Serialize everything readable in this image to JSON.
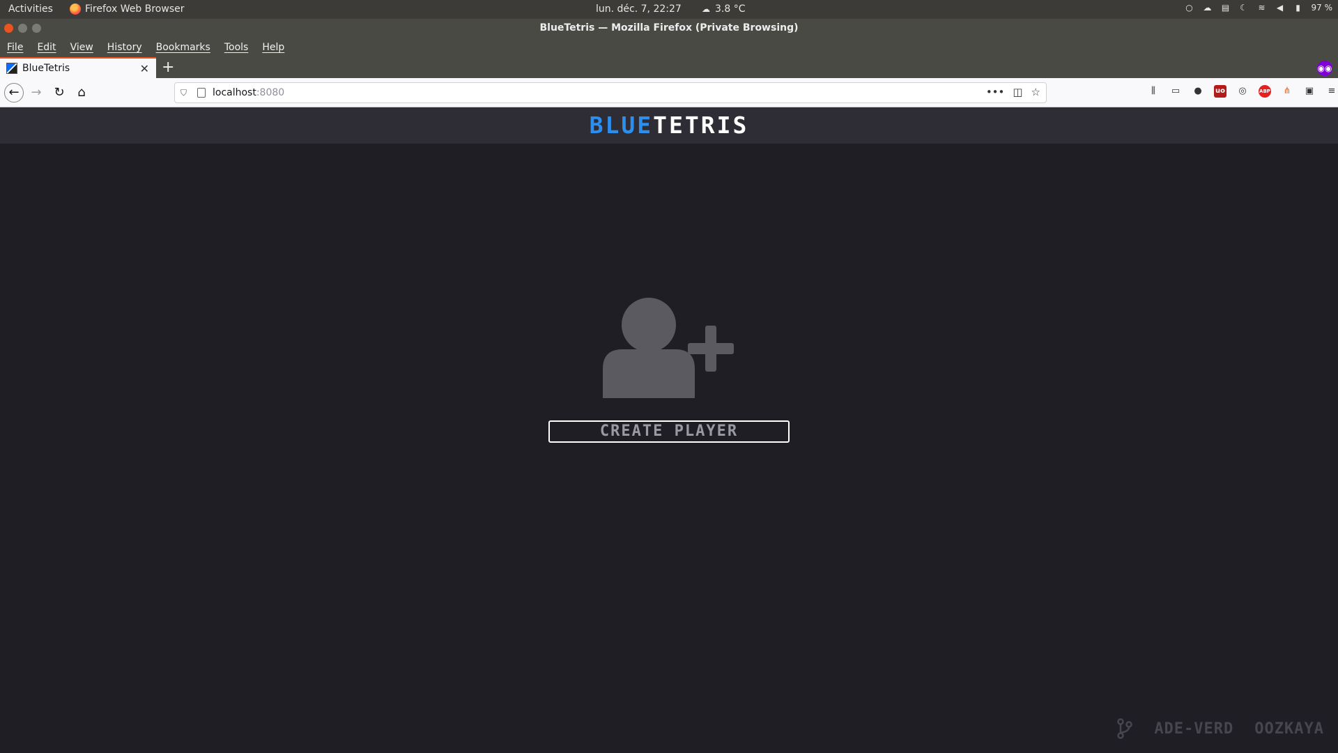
{
  "system": {
    "activities": "Activities",
    "app_name": "Firefox Web Browser",
    "clock": "lun. déc.  7, 22:27",
    "weather": "3.8 °C",
    "battery": "97 %"
  },
  "window": {
    "title": "BlueTetris — Mozilla Firefox (Private Browsing)"
  },
  "menu": [
    {
      "label": "File"
    },
    {
      "label": "Edit"
    },
    {
      "label": "View"
    },
    {
      "label": "History"
    },
    {
      "label": "Bookmarks"
    },
    {
      "label": "Tools"
    },
    {
      "label": "Help"
    }
  ],
  "tab": {
    "title": "BlueTetris"
  },
  "url": {
    "host": "localhost",
    "port": ":8080"
  },
  "app": {
    "brand_blue": "BLUE",
    "brand_white": "TETRIS",
    "create_button": "CREATE PLAYER",
    "footer_names": [
      "ADE-VERD",
      "OOZKAYA"
    ]
  },
  "colors": {
    "accent": "#2b8ff0",
    "background": "#1f1e24",
    "header": "#2e2d36",
    "icon": "#5b5a61"
  },
  "icons": {
    "hero": "user-add-icon",
    "footer": "git-branch-icon"
  }
}
